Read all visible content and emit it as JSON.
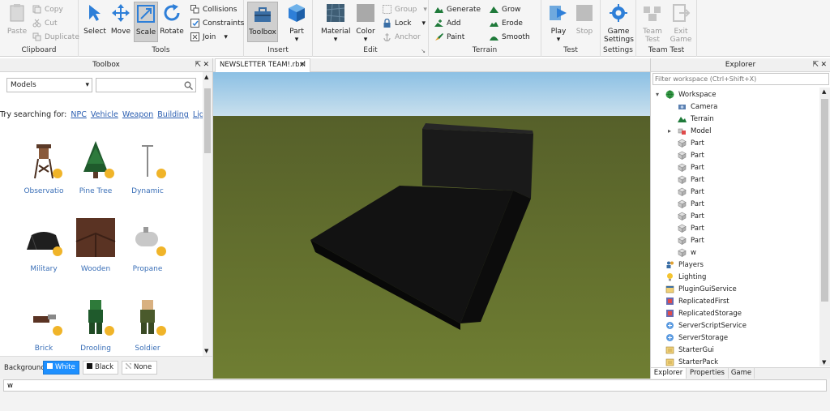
{
  "ribbon": {
    "clipboard": {
      "label": "Clipboard",
      "paste": "Paste",
      "copy": "Copy",
      "cut": "Cut",
      "duplicate": "Duplicate"
    },
    "tools": {
      "label": "Tools",
      "select": "Select",
      "move": "Move",
      "scale": "Scale",
      "rotate": "Rotate",
      "collisions": "Collisions",
      "constraints": "Constraints",
      "join": "Join"
    },
    "insert": {
      "label": "Insert",
      "toolbox": "Toolbox",
      "part": "Part"
    },
    "edit": {
      "label": "Edit",
      "material": "Material",
      "color": "Color",
      "group": "Group",
      "lock": "Lock",
      "anchor": "Anchor"
    },
    "terrain": {
      "label": "Terrain",
      "generate": "Generate",
      "add": "Add",
      "paint": "Paint",
      "grow": "Grow",
      "erode": "Erode",
      "smooth": "Smooth"
    },
    "test": {
      "label": "Test",
      "play": "Play",
      "stop": "Stop"
    },
    "settings": {
      "label": "Settings",
      "game_settings_1": "Game",
      "game_settings_2": "Settings"
    },
    "team_test": {
      "label": "Team Test",
      "team_test_1": "Team",
      "team_test_2": "Test",
      "exit_game_1": "Exit",
      "exit_game_2": "Game"
    }
  },
  "toolbox": {
    "title": "Toolbox",
    "category": "Models",
    "search_placeholder": "",
    "try_searching": "Try searching for:",
    "suggestions": [
      "NPC",
      "Vehicle",
      "Weapon",
      "Building",
      "Light"
    ],
    "items": [
      {
        "label": "Observatio",
        "icon": "tower-icon"
      },
      {
        "label": "Pine Tree",
        "icon": "tree-icon"
      },
      {
        "label": "Dynamic",
        "icon": "lamp-icon"
      },
      {
        "label": "Military",
        "icon": "tent-icon"
      },
      {
        "label": "Wooden",
        "icon": "wood-icon"
      },
      {
        "label": "Propane",
        "icon": "tank-icon"
      },
      {
        "label": "Brick",
        "icon": "brick-icon"
      },
      {
        "label": "Drooling",
        "icon": "zombie-icon"
      },
      {
        "label": "Soldier",
        "icon": "soldier-icon"
      }
    ],
    "background_label": "Background:",
    "bg_white": "White",
    "bg_black": "Black",
    "bg_none": "None"
  },
  "viewport": {
    "tab_title": "NEWSLETTER TEAM!.rbxl",
    "sky_color": "#9fc9e6",
    "ground_color": "#6b7a2f",
    "object_color": "#141414"
  },
  "explorer": {
    "title": "Explorer",
    "filter_placeholder": "Filter workspace (Ctrl+Shift+X)",
    "tree": [
      {
        "label": "Workspace",
        "level": 0,
        "expanded": true,
        "icon": "globe-icon"
      },
      {
        "label": "Camera",
        "level": 1,
        "icon": "camera-icon"
      },
      {
        "label": "Terrain",
        "level": 1,
        "icon": "terrain-icon"
      },
      {
        "label": "Model",
        "level": 1,
        "collapsed": true,
        "icon": "model-icon"
      },
      {
        "label": "Part",
        "level": 1,
        "icon": "part-icon"
      },
      {
        "label": "Part",
        "level": 1,
        "icon": "part-icon"
      },
      {
        "label": "Part",
        "level": 1,
        "icon": "part-icon"
      },
      {
        "label": "Part",
        "level": 1,
        "icon": "part-icon"
      },
      {
        "label": "Part",
        "level": 1,
        "icon": "part-icon"
      },
      {
        "label": "Part",
        "level": 1,
        "icon": "part-icon"
      },
      {
        "label": "Part",
        "level": 1,
        "icon": "part-icon"
      },
      {
        "label": "Part",
        "level": 1,
        "icon": "part-icon"
      },
      {
        "label": "Part",
        "level": 1,
        "icon": "part-icon"
      },
      {
        "label": "w",
        "level": 1,
        "icon": "part-icon"
      },
      {
        "label": "Players",
        "level": 0,
        "icon": "players-icon"
      },
      {
        "label": "Lighting",
        "level": 0,
        "icon": "lighting-icon"
      },
      {
        "label": "PluginGuiService",
        "level": 0,
        "icon": "service-icon"
      },
      {
        "label": "ReplicatedFirst",
        "level": 0,
        "icon": "replicated-icon"
      },
      {
        "label": "ReplicatedStorage",
        "level": 0,
        "icon": "replicated-icon"
      },
      {
        "label": "ServerScriptService",
        "level": 0,
        "icon": "server-icon"
      },
      {
        "label": "ServerStorage",
        "level": 0,
        "icon": "server-icon"
      },
      {
        "label": "StarterGui",
        "level": 0,
        "icon": "starter-icon"
      },
      {
        "label": "StarterPack",
        "level": 0,
        "icon": "starter-icon"
      }
    ],
    "tabs": [
      "Explorer",
      "Properties",
      "Game"
    ]
  },
  "command_bar": {
    "value": "w"
  }
}
